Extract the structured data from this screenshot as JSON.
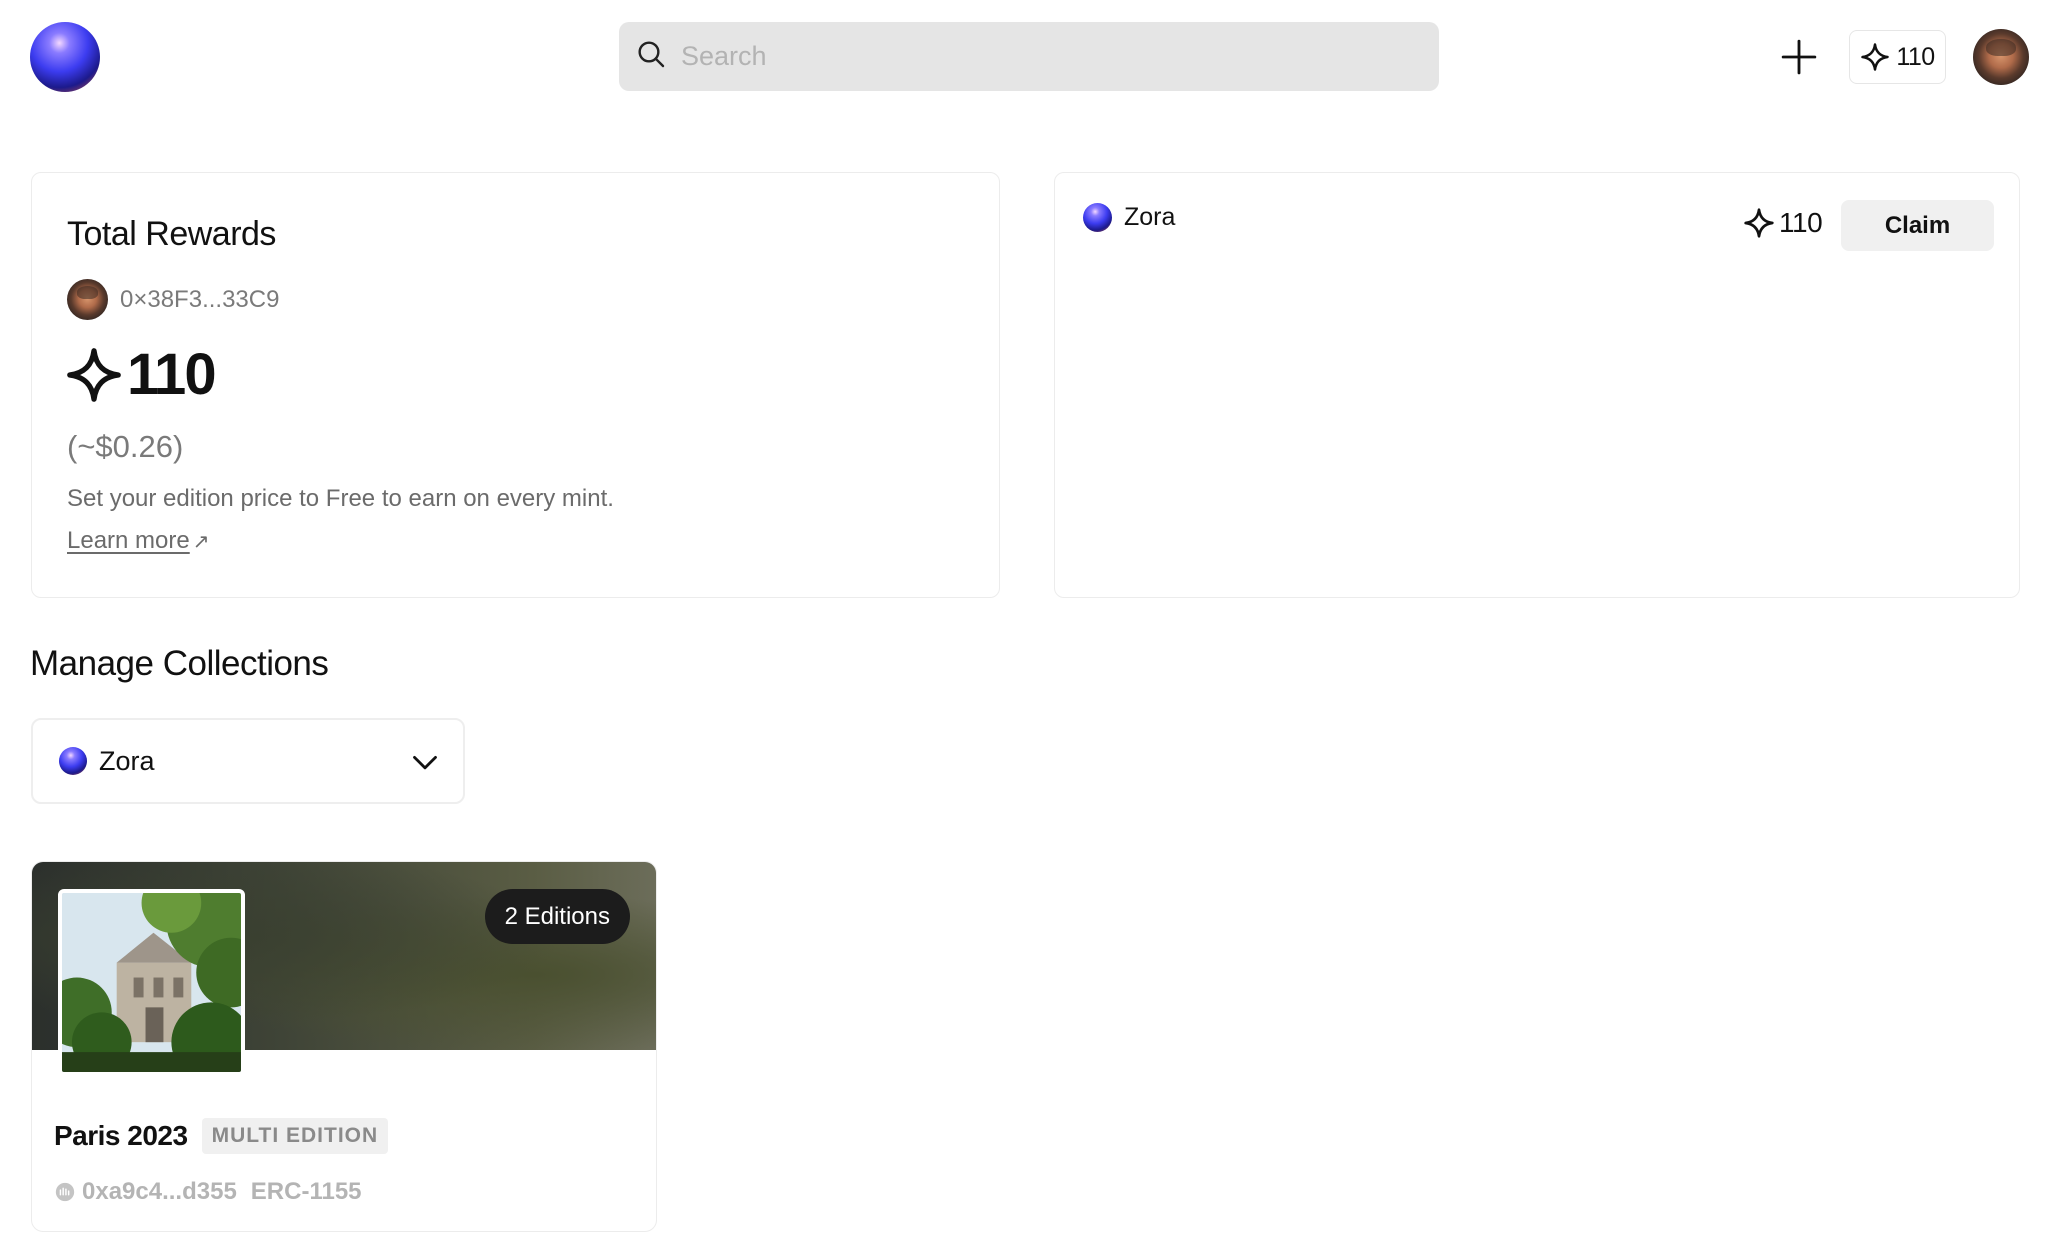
{
  "header": {
    "logo_icon": "zora-orb-logo",
    "search": {
      "placeholder": "Search",
      "value": ""
    },
    "create_icon": "plus-icon",
    "points": "110",
    "points_icon": "sparkle-icon",
    "profile_icon": "avatar"
  },
  "rewards": {
    "title": "Total Rewards",
    "address": "0×38F3...33C9",
    "points": "110",
    "usd": "(~$0.26)",
    "note": "Set your edition price to Free to earn on every mint.",
    "learn_more": "Learn more",
    "learn_more_arrow": "↗"
  },
  "claim": {
    "name": "Zora",
    "points": "110",
    "button": "Claim"
  },
  "manage": {
    "title": "Manage Collections",
    "selected": "Zora"
  },
  "collection": {
    "editions": "2 Editions",
    "name": "Paris 2023",
    "type_badge": "MULTI EDITION",
    "address": "0xa9c4...d355",
    "standard": "ERC-1155"
  },
  "colors": {
    "search_bg": "#e5e5e5",
    "claim_button_bg": "#f0f0f0",
    "editions_pill_bg": "#1c1c1c",
    "muted_text": "#7a7a7a"
  }
}
